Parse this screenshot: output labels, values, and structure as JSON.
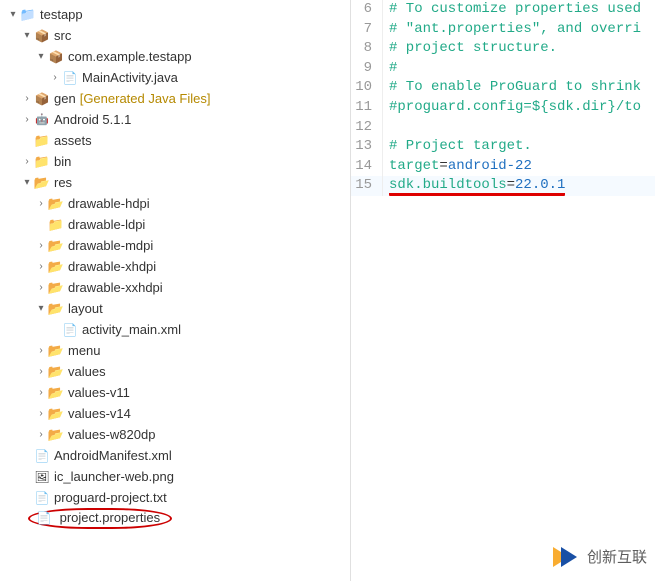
{
  "tree": {
    "root": "testapp",
    "src": "src",
    "pkg": "com.example.testapp",
    "main_activity": "MainActivity.java",
    "gen": "gen",
    "gen_note": "[Generated Java Files]",
    "android": "Android 5.1.1",
    "assets": "assets",
    "bin": "bin",
    "res": "res",
    "drawable_hdpi": "drawable-hdpi",
    "drawable_ldpi": "drawable-ldpi",
    "drawable_mdpi": "drawable-mdpi",
    "drawable_xhdpi": "drawable-xhdpi",
    "drawable_xxhdpi": "drawable-xxhdpi",
    "layout": "layout",
    "activity_main": "activity_main.xml",
    "menu": "menu",
    "values": "values",
    "values_v11": "values-v11",
    "values_v14": "values-v14",
    "values_w820dp": "values-w820dp",
    "manifest": "AndroidManifest.xml",
    "ic_launcher": "ic_launcher-web.png",
    "proguard": "proguard-project.txt",
    "project_props": "project.properties"
  },
  "code": {
    "l6": {
      "n": "6",
      "text": "# To customize properties used"
    },
    "l7": {
      "n": "7",
      "text": "# \"ant.properties\", and overri"
    },
    "l8": {
      "n": "8",
      "text": "# project structure."
    },
    "l9": {
      "n": "9",
      "text": "#"
    },
    "l10": {
      "n": "10",
      "text": "# To enable ProGuard to shrink"
    },
    "l11": {
      "n": "11",
      "text": "#proguard.config=${sdk.dir}/to"
    },
    "l12": {
      "n": "12",
      "text": ""
    },
    "l13": {
      "n": "13",
      "text": "# Project target."
    },
    "l14": {
      "n": "14",
      "key": "target",
      "val": "android-22"
    },
    "l15": {
      "n": "15",
      "key": "sdk.buildtools",
      "val": "22.0.1"
    }
  },
  "watermark": "创新互联"
}
